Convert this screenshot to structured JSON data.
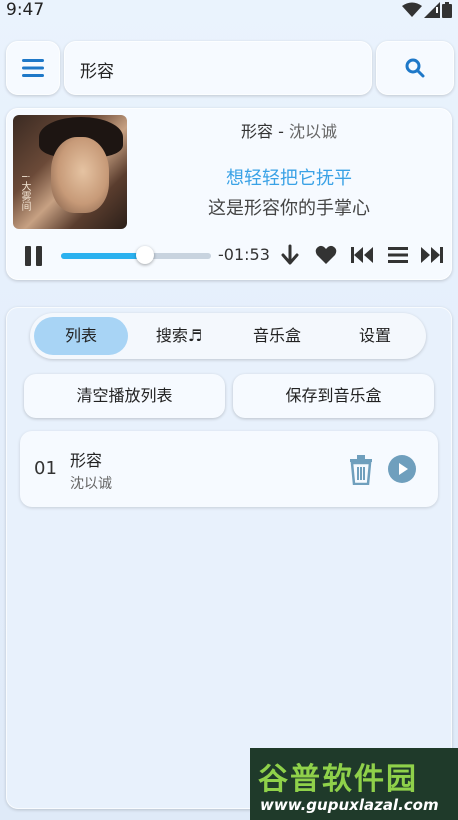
{
  "status": {
    "time": "9:47"
  },
  "search": {
    "value": "形容"
  },
  "player": {
    "song_title": "形容",
    "separator": " - ",
    "artist": "沈以诚",
    "lyric_current": "想轻轻把它抚平",
    "lyric_next": "这是形容你的手掌心",
    "remaining": "-01:53",
    "progress": 0.56,
    "cover_text": "i 大雾间"
  },
  "tabs": [
    "列表",
    "搜索♬",
    "音乐盒",
    "设置"
  ],
  "active_tab": 0,
  "actions": {
    "clear": "清空播放列表",
    "save": "保存到音乐盒"
  },
  "playlist": [
    {
      "index": "01",
      "title": "形容",
      "artist": "沈以诚"
    }
  ],
  "watermark": {
    "title": "谷普软件园",
    "url": "www.gupuxlazal.com"
  },
  "colors": {
    "accent": "#2bb1ef",
    "lyric": "#3aa2e6",
    "menu_icon": "#1e78c8",
    "tab_active": "#a8d4f5"
  }
}
